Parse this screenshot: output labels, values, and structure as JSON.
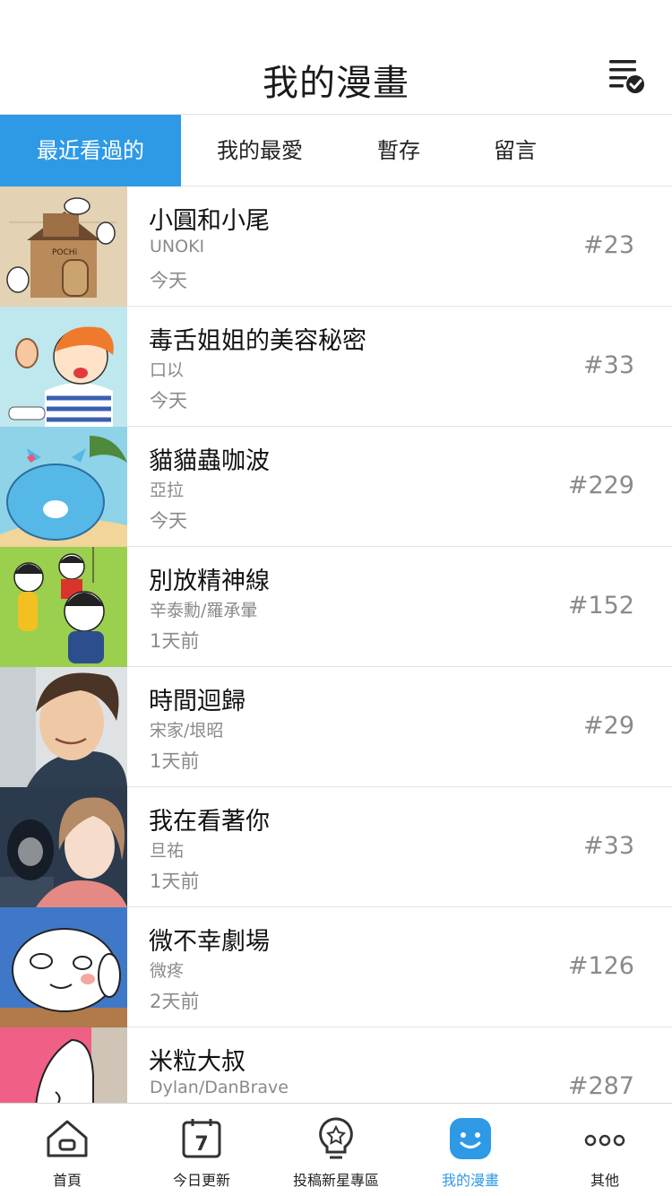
{
  "header": {
    "title": "我的漫畫",
    "edit_icon": "list-check-icon"
  },
  "tabs": [
    {
      "label": "最近看過的",
      "active": true
    },
    {
      "label": "我的最愛",
      "active": false
    },
    {
      "label": "暫存",
      "active": false
    },
    {
      "label": "留言",
      "active": false
    }
  ],
  "items": [
    {
      "title": "小圓和小尾",
      "author": "UNOKI",
      "date": "今天",
      "episode": "#23"
    },
    {
      "title": "毒舌姐姐的美容秘密",
      "author": "口以",
      "date": "今天",
      "episode": "#33"
    },
    {
      "title": "貓貓蟲咖波",
      "author": "亞拉",
      "date": "今天",
      "episode": "#229"
    },
    {
      "title": "別放精神線",
      "author": "辛泰勳/羅承暈",
      "date": "1天前",
      "episode": "#152"
    },
    {
      "title": "時間迴歸",
      "author": "宋家/垠昭",
      "date": "1天前",
      "episode": "#29"
    },
    {
      "title": "我在看著你",
      "author": "旦祐",
      "date": "1天前",
      "episode": "#33"
    },
    {
      "title": "微不幸劇場",
      "author": "微疼",
      "date": "2天前",
      "episode": "#126"
    },
    {
      "title": "米粒大叔",
      "author": "Dylan/DanBrave",
      "date": "",
      "episode": "#287"
    }
  ],
  "bottom_nav": [
    {
      "label": "首頁",
      "icon": "home-icon"
    },
    {
      "label": "今日更新",
      "icon": "calendar-icon",
      "day": "7"
    },
    {
      "label": "投稿新星專區",
      "icon": "lightbulb-star-icon"
    },
    {
      "label": "我的漫畫",
      "icon": "smile-icon",
      "active": true
    },
    {
      "label": "其他",
      "icon": "more-icon"
    }
  ],
  "colors": {
    "accent": "#2e9ae6",
    "divider": "#e3e3e3",
    "secondary_text": "#8a8a8a"
  }
}
